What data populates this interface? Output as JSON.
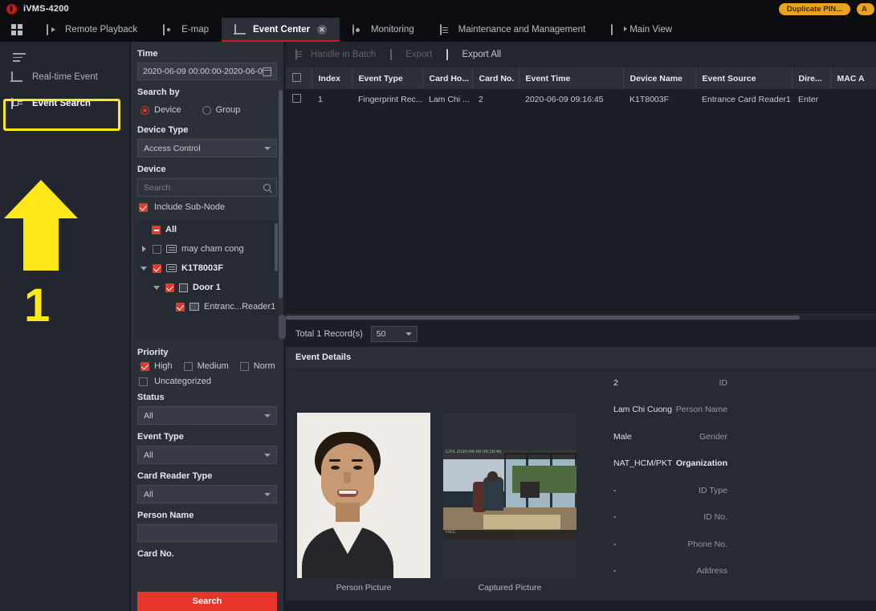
{
  "titlebar": {
    "app_name": "iVMS-4200",
    "logo_icon": "hikvision-logo-icon"
  },
  "nav": {
    "grid_icon": "app-grid-icon",
    "items": [
      {
        "label": "Remote Playback",
        "icon": "playback-icon",
        "active": false
      },
      {
        "label": "E-map",
        "icon": "emap-icon",
        "active": false
      },
      {
        "label": "Event Center",
        "icon": "bell-icon",
        "active": true,
        "closable": true
      },
      {
        "label": "Monitoring",
        "icon": "monitoring-icon",
        "active": false
      },
      {
        "label": "Maintenance and Management",
        "icon": "maintenance-icon",
        "active": false
      },
      {
        "label": "Main View",
        "icon": "camera-icon",
        "active": false
      }
    ],
    "badges": [
      {
        "label": "Duplicate PIN...",
        "color": "#e8a41f"
      },
      {
        "label": "A",
        "color": "#e8a41f"
      }
    ]
  },
  "sidebar": {
    "menu_icon": "hamburger-icon",
    "items": [
      {
        "label": "Real-time Event",
        "icon": "bell-icon",
        "selected": false
      },
      {
        "label": "Event Search",
        "icon": "event-search-icon",
        "selected": true
      }
    ],
    "annotation": {
      "step_number": "1",
      "arrow_icon": "up-arrow-annotation",
      "highlight_color": "#ffe81a"
    }
  },
  "filter": {
    "time_label": "Time",
    "time_value": "2020-06-09 00:00:00-2020-06-0...",
    "calendar_icon": "calendar-icon",
    "search_by_label": "Search by",
    "search_by_options": [
      {
        "label": "Device",
        "selected": true
      },
      {
        "label": "Group",
        "selected": false
      }
    ],
    "device_type_label": "Device Type",
    "device_type_value": "Access Control",
    "device_label": "Device",
    "device_search_placeholder": "Search",
    "search_icon": "magnifier-icon",
    "include_sub_node_label": "Include Sub-Node",
    "include_sub_node_checked": true,
    "tree": [
      {
        "label": "All",
        "state": "indeterminate",
        "indent": 0,
        "twist": "none",
        "icon": "none",
        "bold": true
      },
      {
        "label": "may cham cong",
        "state": "unchecked",
        "indent": 1,
        "twist": "right",
        "icon": "device-icon",
        "bold": false
      },
      {
        "label": "K1T8003F",
        "state": "checked",
        "indent": 1,
        "twist": "down",
        "icon": "device-icon",
        "bold": true
      },
      {
        "label": "Door 1",
        "state": "checked",
        "indent": 2,
        "twist": "down",
        "icon": "door-icon",
        "bold": true
      },
      {
        "label": "Entranc...Reader1",
        "state": "checked",
        "indent": 3,
        "twist": "none",
        "icon": "card-reader-icon",
        "bold": false
      }
    ],
    "priority_label": "Priority",
    "priority_options": [
      {
        "label": "High",
        "checked": true
      },
      {
        "label": "Medium",
        "checked": false
      },
      {
        "label": "Norm",
        "checked": false
      },
      {
        "label": "Uncategorized",
        "checked": false
      }
    ],
    "status_label": "Status",
    "status_value": "All",
    "event_type_label": "Event Type",
    "event_type_value": "All",
    "card_reader_type_label": "Card Reader Type",
    "card_reader_type_value": "All",
    "person_name_label": "Person Name",
    "person_name_value": "",
    "card_no_label": "Card No.",
    "search_button": "Search",
    "search_button_color": "#e8342a"
  },
  "toolbar": {
    "handle_in_batch": "Handle in Batch",
    "handle_in_batch_icon": "batch-icon",
    "export": "Export",
    "export_icon": "export-icon",
    "export_all": "Export All",
    "export_all_icon": "export-icon"
  },
  "table": {
    "columns": [
      "Index",
      "Event Type",
      "Card Ho...",
      "Card No.",
      "Event Time",
      "Device Name",
      "Event Source",
      "Dire...",
      "MAC A"
    ],
    "rows": [
      {
        "index": "1",
        "event_type": "Fingerprint Rec...",
        "card_holder": "Lam Chi ...",
        "card_no": "2",
        "event_time": "2020-06-09 09:16:45",
        "device_name": "K1T8003F",
        "event_source": "Entrance Card Reader1",
        "direction": "Enter",
        "mac": ""
      }
    ]
  },
  "footer": {
    "total_text": "Total 1 Record(s)",
    "page_size": "50"
  },
  "details": {
    "header": "Event Details",
    "person_picture_caption": "Person Picture",
    "captured_picture_caption": "Captured Picture",
    "fields": [
      {
        "key": "ID",
        "value": "2",
        "bold": false
      },
      {
        "key": "Person Name",
        "value": "Lam Chi Cuong",
        "bold": false
      },
      {
        "key": "Gender",
        "value": "Male",
        "bold": false
      },
      {
        "key": "Organization",
        "value": "NAT_HCM/PKT",
        "bold": true
      },
      {
        "key": "ID Type",
        "value": "-",
        "bold": false
      },
      {
        "key": "ID No.",
        "value": "-",
        "bold": false
      },
      {
        "key": "Phone No.",
        "value": "-",
        "bold": false
      },
      {
        "key": "Address",
        "value": "-",
        "bold": false
      }
    ]
  }
}
